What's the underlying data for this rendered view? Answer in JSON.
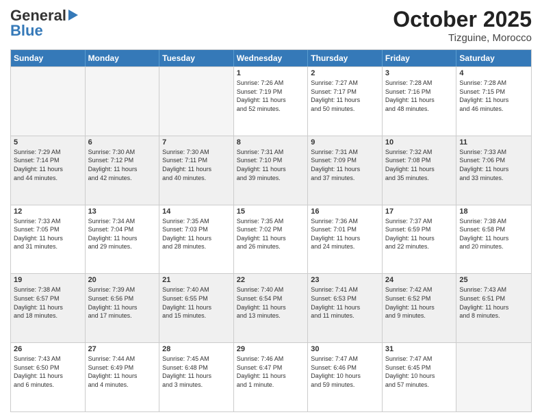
{
  "header": {
    "logo_general": "General",
    "logo_blue": "Blue",
    "month_title": "October 2025",
    "location": "Tizguine, Morocco"
  },
  "days_of_week": [
    "Sunday",
    "Monday",
    "Tuesday",
    "Wednesday",
    "Thursday",
    "Friday",
    "Saturday"
  ],
  "weeks": [
    [
      {
        "day": "",
        "info": ""
      },
      {
        "day": "",
        "info": ""
      },
      {
        "day": "",
        "info": ""
      },
      {
        "day": "1",
        "info": "Sunrise: 7:26 AM\nSunset: 7:19 PM\nDaylight: 11 hours\nand 52 minutes."
      },
      {
        "day": "2",
        "info": "Sunrise: 7:27 AM\nSunset: 7:17 PM\nDaylight: 11 hours\nand 50 minutes."
      },
      {
        "day": "3",
        "info": "Sunrise: 7:28 AM\nSunset: 7:16 PM\nDaylight: 11 hours\nand 48 minutes."
      },
      {
        "day": "4",
        "info": "Sunrise: 7:28 AM\nSunset: 7:15 PM\nDaylight: 11 hours\nand 46 minutes."
      }
    ],
    [
      {
        "day": "5",
        "info": "Sunrise: 7:29 AM\nSunset: 7:14 PM\nDaylight: 11 hours\nand 44 minutes."
      },
      {
        "day": "6",
        "info": "Sunrise: 7:30 AM\nSunset: 7:12 PM\nDaylight: 11 hours\nand 42 minutes."
      },
      {
        "day": "7",
        "info": "Sunrise: 7:30 AM\nSunset: 7:11 PM\nDaylight: 11 hours\nand 40 minutes."
      },
      {
        "day": "8",
        "info": "Sunrise: 7:31 AM\nSunset: 7:10 PM\nDaylight: 11 hours\nand 39 minutes."
      },
      {
        "day": "9",
        "info": "Sunrise: 7:31 AM\nSunset: 7:09 PM\nDaylight: 11 hours\nand 37 minutes."
      },
      {
        "day": "10",
        "info": "Sunrise: 7:32 AM\nSunset: 7:08 PM\nDaylight: 11 hours\nand 35 minutes."
      },
      {
        "day": "11",
        "info": "Sunrise: 7:33 AM\nSunset: 7:06 PM\nDaylight: 11 hours\nand 33 minutes."
      }
    ],
    [
      {
        "day": "12",
        "info": "Sunrise: 7:33 AM\nSunset: 7:05 PM\nDaylight: 11 hours\nand 31 minutes."
      },
      {
        "day": "13",
        "info": "Sunrise: 7:34 AM\nSunset: 7:04 PM\nDaylight: 11 hours\nand 29 minutes."
      },
      {
        "day": "14",
        "info": "Sunrise: 7:35 AM\nSunset: 7:03 PM\nDaylight: 11 hours\nand 28 minutes."
      },
      {
        "day": "15",
        "info": "Sunrise: 7:35 AM\nSunset: 7:02 PM\nDaylight: 11 hours\nand 26 minutes."
      },
      {
        "day": "16",
        "info": "Sunrise: 7:36 AM\nSunset: 7:01 PM\nDaylight: 11 hours\nand 24 minutes."
      },
      {
        "day": "17",
        "info": "Sunrise: 7:37 AM\nSunset: 6:59 PM\nDaylight: 11 hours\nand 22 minutes."
      },
      {
        "day": "18",
        "info": "Sunrise: 7:38 AM\nSunset: 6:58 PM\nDaylight: 11 hours\nand 20 minutes."
      }
    ],
    [
      {
        "day": "19",
        "info": "Sunrise: 7:38 AM\nSunset: 6:57 PM\nDaylight: 11 hours\nand 18 minutes."
      },
      {
        "day": "20",
        "info": "Sunrise: 7:39 AM\nSunset: 6:56 PM\nDaylight: 11 hours\nand 17 minutes."
      },
      {
        "day": "21",
        "info": "Sunrise: 7:40 AM\nSunset: 6:55 PM\nDaylight: 11 hours\nand 15 minutes."
      },
      {
        "day": "22",
        "info": "Sunrise: 7:40 AM\nSunset: 6:54 PM\nDaylight: 11 hours\nand 13 minutes."
      },
      {
        "day": "23",
        "info": "Sunrise: 7:41 AM\nSunset: 6:53 PM\nDaylight: 11 hours\nand 11 minutes."
      },
      {
        "day": "24",
        "info": "Sunrise: 7:42 AM\nSunset: 6:52 PM\nDaylight: 11 hours\nand 9 minutes."
      },
      {
        "day": "25",
        "info": "Sunrise: 7:43 AM\nSunset: 6:51 PM\nDaylight: 11 hours\nand 8 minutes."
      }
    ],
    [
      {
        "day": "26",
        "info": "Sunrise: 7:43 AM\nSunset: 6:50 PM\nDaylight: 11 hours\nand 6 minutes."
      },
      {
        "day": "27",
        "info": "Sunrise: 7:44 AM\nSunset: 6:49 PM\nDaylight: 11 hours\nand 4 minutes."
      },
      {
        "day": "28",
        "info": "Sunrise: 7:45 AM\nSunset: 6:48 PM\nDaylight: 11 hours\nand 3 minutes."
      },
      {
        "day": "29",
        "info": "Sunrise: 7:46 AM\nSunset: 6:47 PM\nDaylight: 11 hours\nand 1 minute."
      },
      {
        "day": "30",
        "info": "Sunrise: 7:47 AM\nSunset: 6:46 PM\nDaylight: 10 hours\nand 59 minutes."
      },
      {
        "day": "31",
        "info": "Sunrise: 7:47 AM\nSunset: 6:45 PM\nDaylight: 10 hours\nand 57 minutes."
      },
      {
        "day": "",
        "info": ""
      }
    ]
  ]
}
